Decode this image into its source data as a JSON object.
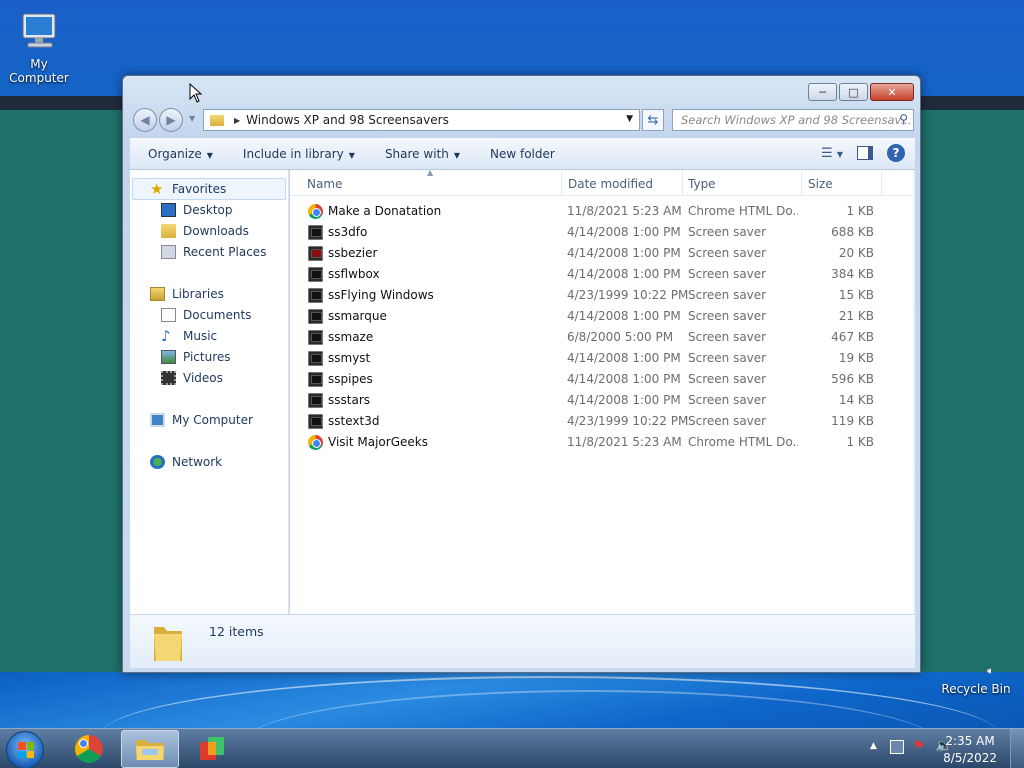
{
  "desktop": {
    "icons": [
      {
        "label": "My Computer"
      },
      {
        "label": "Recycle Bin"
      }
    ]
  },
  "window": {
    "address": {
      "path": "Windows XP and 98 Screensavers",
      "separator": "▶"
    },
    "search": {
      "placeholder": "Search Windows XP and 98 Screensav..."
    },
    "toolbar": {
      "organize": "Organize",
      "include_in_library": "Include in library",
      "share_with": "Share with",
      "new_folder": "New folder"
    },
    "nav": {
      "favorites": "Favorites",
      "desktop": "Desktop",
      "downloads": "Downloads",
      "recent_places": "Recent Places",
      "libraries": "Libraries",
      "documents": "Documents",
      "music": "Music",
      "pictures": "Pictures",
      "videos": "Videos",
      "my_computer": "My Computer",
      "network": "Network"
    },
    "columns": {
      "name": "Name",
      "date_modified": "Date modified",
      "type": "Type",
      "size": "Size"
    },
    "files": [
      {
        "name": "Make a Donatation",
        "date": "11/8/2021 5:23 AM",
        "type": "Chrome HTML Do...",
        "size": "1 KB",
        "icon": "chrome-icon"
      },
      {
        "name": "ss3dfo",
        "date": "4/14/2008 1:00 PM",
        "type": "Screen saver",
        "size": "688 KB",
        "icon": "screensaver-icon"
      },
      {
        "name": "ssbezier",
        "date": "4/14/2008 1:00 PM",
        "type": "Screen saver",
        "size": "20 KB",
        "icon": "screensaver-icon"
      },
      {
        "name": "ssflwbox",
        "date": "4/14/2008 1:00 PM",
        "type": "Screen saver",
        "size": "384 KB",
        "icon": "screensaver-icon"
      },
      {
        "name": "ssFlying Windows",
        "date": "4/23/1999 10:22 PM",
        "type": "Screen saver",
        "size": "15 KB",
        "icon": "screensaver-icon"
      },
      {
        "name": "ssmarque",
        "date": "4/14/2008 1:00 PM",
        "type": "Screen saver",
        "size": "21 KB",
        "icon": "screensaver-icon"
      },
      {
        "name": "ssmaze",
        "date": "6/8/2000 5:00 PM",
        "type": "Screen saver",
        "size": "467 KB",
        "icon": "screensaver-icon"
      },
      {
        "name": "ssmyst",
        "date": "4/14/2008 1:00 PM",
        "type": "Screen saver",
        "size": "19 KB",
        "icon": "screensaver-icon"
      },
      {
        "name": "sspipes",
        "date": "4/14/2008 1:00 PM",
        "type": "Screen saver",
        "size": "596 KB",
        "icon": "screensaver-icon"
      },
      {
        "name": "ssstars",
        "date": "4/14/2008 1:00 PM",
        "type": "Screen saver",
        "size": "14 KB",
        "icon": "screensaver-icon"
      },
      {
        "name": "sstext3d",
        "date": "4/23/1999 10:22 PM",
        "type": "Screen saver",
        "size": "119 KB",
        "icon": "screensaver-icon"
      },
      {
        "name": "Visit MajorGeeks",
        "date": "11/8/2021 5:23 AM",
        "type": "Chrome HTML Do...",
        "size": "1 KB",
        "icon": "chrome-icon"
      }
    ],
    "details": {
      "item_count": "12 items"
    }
  },
  "taskbar": {
    "clock_time": "2:35 AM",
    "clock_date": "8/5/2022"
  },
  "colors": {
    "accent": "#1e395b",
    "selection": "#eef5fd",
    "close_button": "#c6402b"
  }
}
